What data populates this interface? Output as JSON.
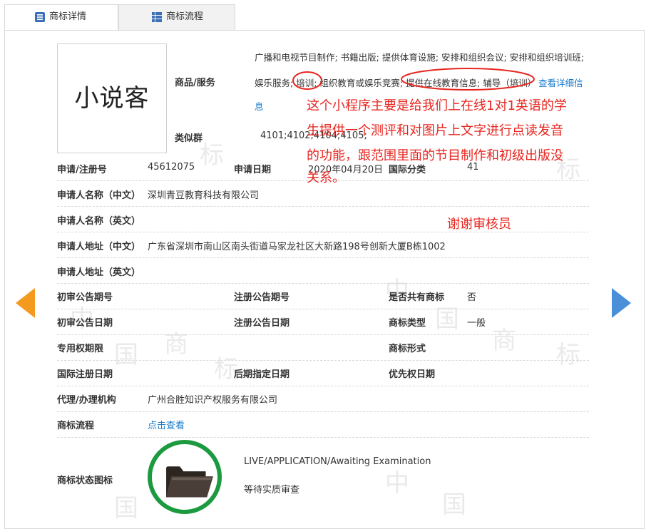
{
  "tabs": [
    {
      "label": "商标详情",
      "icon": "list-icon",
      "active": true
    },
    {
      "label": "商标流程",
      "icon": "grid-icon",
      "active": false
    }
  ],
  "logo": {
    "text": "小说客"
  },
  "goods": {
    "label": "商品/服务",
    "line1": "广播和电视节目制作; 书籍出版; 提供体育设施; 安排和组织会议; 安排和组织培训班;",
    "line2_a": "娱乐服务;",
    "line2_b": "培训;",
    "line2_c": "组织教育或娱乐竞赛;",
    "line2_d": "提供在线教育信息; 辅导（培训）",
    "more_link": "查看详细信",
    "more_link_2": "息"
  },
  "similar_group": {
    "label": "类似群",
    "value": "4101;4102;4104;4105;"
  },
  "rows": {
    "reg_no_label": "申请/注册号",
    "reg_no": "45612075",
    "apply_date_label": "申请日期",
    "apply_date": "2020年04月20日",
    "intl_class_label": "国际分类",
    "intl_class": "41",
    "applicant_cn_label": "申请人名称（中文）",
    "applicant_cn": "深圳青豆教育科技有限公司",
    "applicant_en_label": "申请人名称（英文）",
    "address_cn_label": "申请人地址（中文）",
    "address_cn": "广东省深圳市南山区南头街道马家龙社区大新路198号创新大厦B栋1002",
    "address_en_label": "申请人地址（英文）",
    "prelim_no_label": "初审公告期号",
    "reg_pub_no_label": "注册公告期号",
    "shared_label": "是否共有商标",
    "shared": "否",
    "prelim_date_label": "初审公告日期",
    "reg_pub_date_label": "注册公告日期",
    "mark_type_label": "商标类型",
    "mark_type": "一般",
    "exclusive_label": "专用权期限",
    "mark_form_label": "商标形式",
    "intl_reg_date_label": "国际注册日期",
    "later_date_label": "后期指定日期",
    "priority_label": "优先权日期",
    "agent_label": "代理/办理机构",
    "agent": "广州合胜知识产权服务有限公司",
    "flow_label": "商标流程",
    "flow_link": "点击查看",
    "status_icon_label": "商标状态图标",
    "status_en": "LIVE/APPLICATION/Awaiting Examination",
    "status_cn": "等待实质审查"
  },
  "annotation": {
    "line1": "这个小程序主要是给我们上在线1对1英语的学",
    "line2": "生提供一个测评和对图片上文字进行点读发音",
    "line3": "的功能，跟范围里面的节目制作和初级出版没",
    "line4": "关系。",
    "thanks": "谢谢审核员"
  },
  "watermark": [
    "中",
    "国",
    "商",
    "标"
  ],
  "colors": {
    "annotation_red": "#e8251f",
    "link_blue": "#1a7bc9",
    "arrow_orange": "#f39a1f",
    "arrow_blue": "#4a90d9",
    "status_green": "#1c9a3f"
  }
}
